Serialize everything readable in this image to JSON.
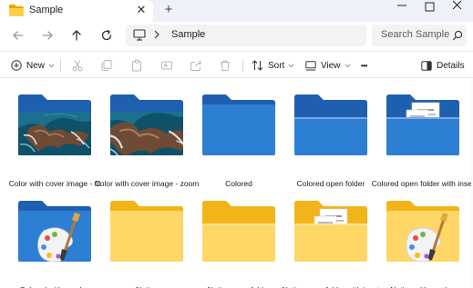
{
  "window": {
    "tab_title": "Sample",
    "tab_close": "✕",
    "new_tab": "+"
  },
  "nav": {
    "path": "Sample",
    "search_placeholder": "Search Sample"
  },
  "toolbar": {
    "new_label": "New",
    "sort_label": "Sort",
    "view_label": "View",
    "more_label": "•••",
    "details_label": "Details"
  },
  "items": [
    {
      "label": "Color with cover image - fit",
      "type": "colored-image"
    },
    {
      "label": "Color with cover image - zoom",
      "type": "colored-image-zoom"
    },
    {
      "label": "Colored",
      "type": "colored"
    },
    {
      "label": "Colored open folder",
      "type": "colored-open"
    },
    {
      "label": "Colored open folder with inset",
      "type": "colored-inset"
    },
    {
      "label": "Colored with overlay",
      "type": "colored-overlay"
    },
    {
      "label": "Native",
      "type": "native"
    },
    {
      "label": "Native open folder",
      "type": "native-open"
    },
    {
      "label": "Native open folder with inset",
      "type": "native-inset"
    },
    {
      "label": "Native with overlay",
      "type": "native-overlay"
    }
  ],
  "colors": {
    "blue_back": "#1f5fb0",
    "blue_front": "#2d7fd3",
    "yellow_back": "#f2b418",
    "yellow_front": "#ffd766"
  }
}
